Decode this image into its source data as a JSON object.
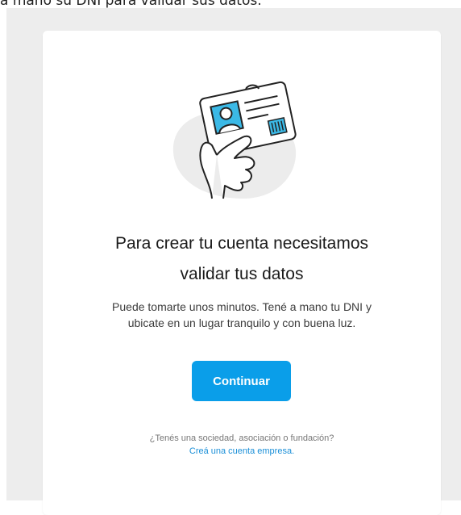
{
  "caption": "a mano su DNI para validar sus datos.",
  "illustration": {
    "icon": "id-card-in-hand-icon",
    "accent": "#3bb9e6"
  },
  "heading": {
    "line1": "Para crear tu cuenta necesitamos",
    "line2": "validar tus datos"
  },
  "description": {
    "line1": "Puede tomarte unos minutos. Tené a mano tu DNI y",
    "line2": "ubicate en un lugar tranquilo y con buena luz."
  },
  "primary_button": {
    "label": "Continuar",
    "color": "#0a9ee9"
  },
  "footer": {
    "question": "¿Tenés una sociedad, asociación o fundación?",
    "link_label": "Creá una cuenta empresa."
  }
}
